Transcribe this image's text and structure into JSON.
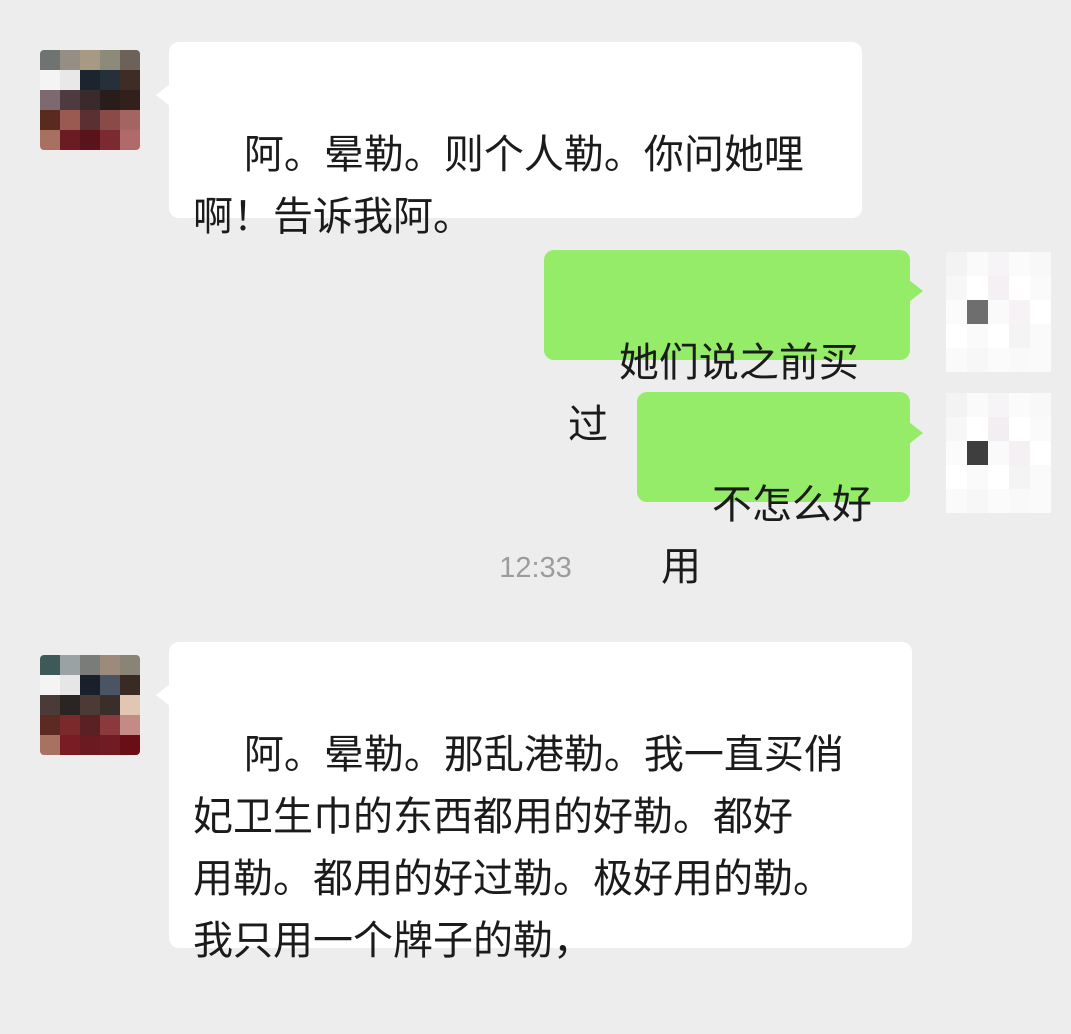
{
  "messages": [
    {
      "side": "in",
      "text": "阿。晕勒。则个人勒。你问她哩\n啊！告诉我阿。"
    },
    {
      "side": "out",
      "text": "她们说之前买过"
    },
    {
      "side": "out",
      "text": "不怎么好用"
    },
    {
      "side": "in",
      "text": "阿。晕勒。那乱港勒。我一直买俏\n妃卫生巾的东西都用的好勒。都好\n用勒。都用的好过勒。极好用的勒。\n我只用一个牌子的勒，"
    }
  ],
  "timestamp": "12:33",
  "colors": {
    "background": "#ededed",
    "incoming_bubble": "#ffffff",
    "outgoing_bubble": "#95ec69",
    "timestamp_text": "#9c9c9c"
  },
  "avatars": {
    "contact": "pixelated-avatar",
    "self": "pixelated-avatar"
  }
}
